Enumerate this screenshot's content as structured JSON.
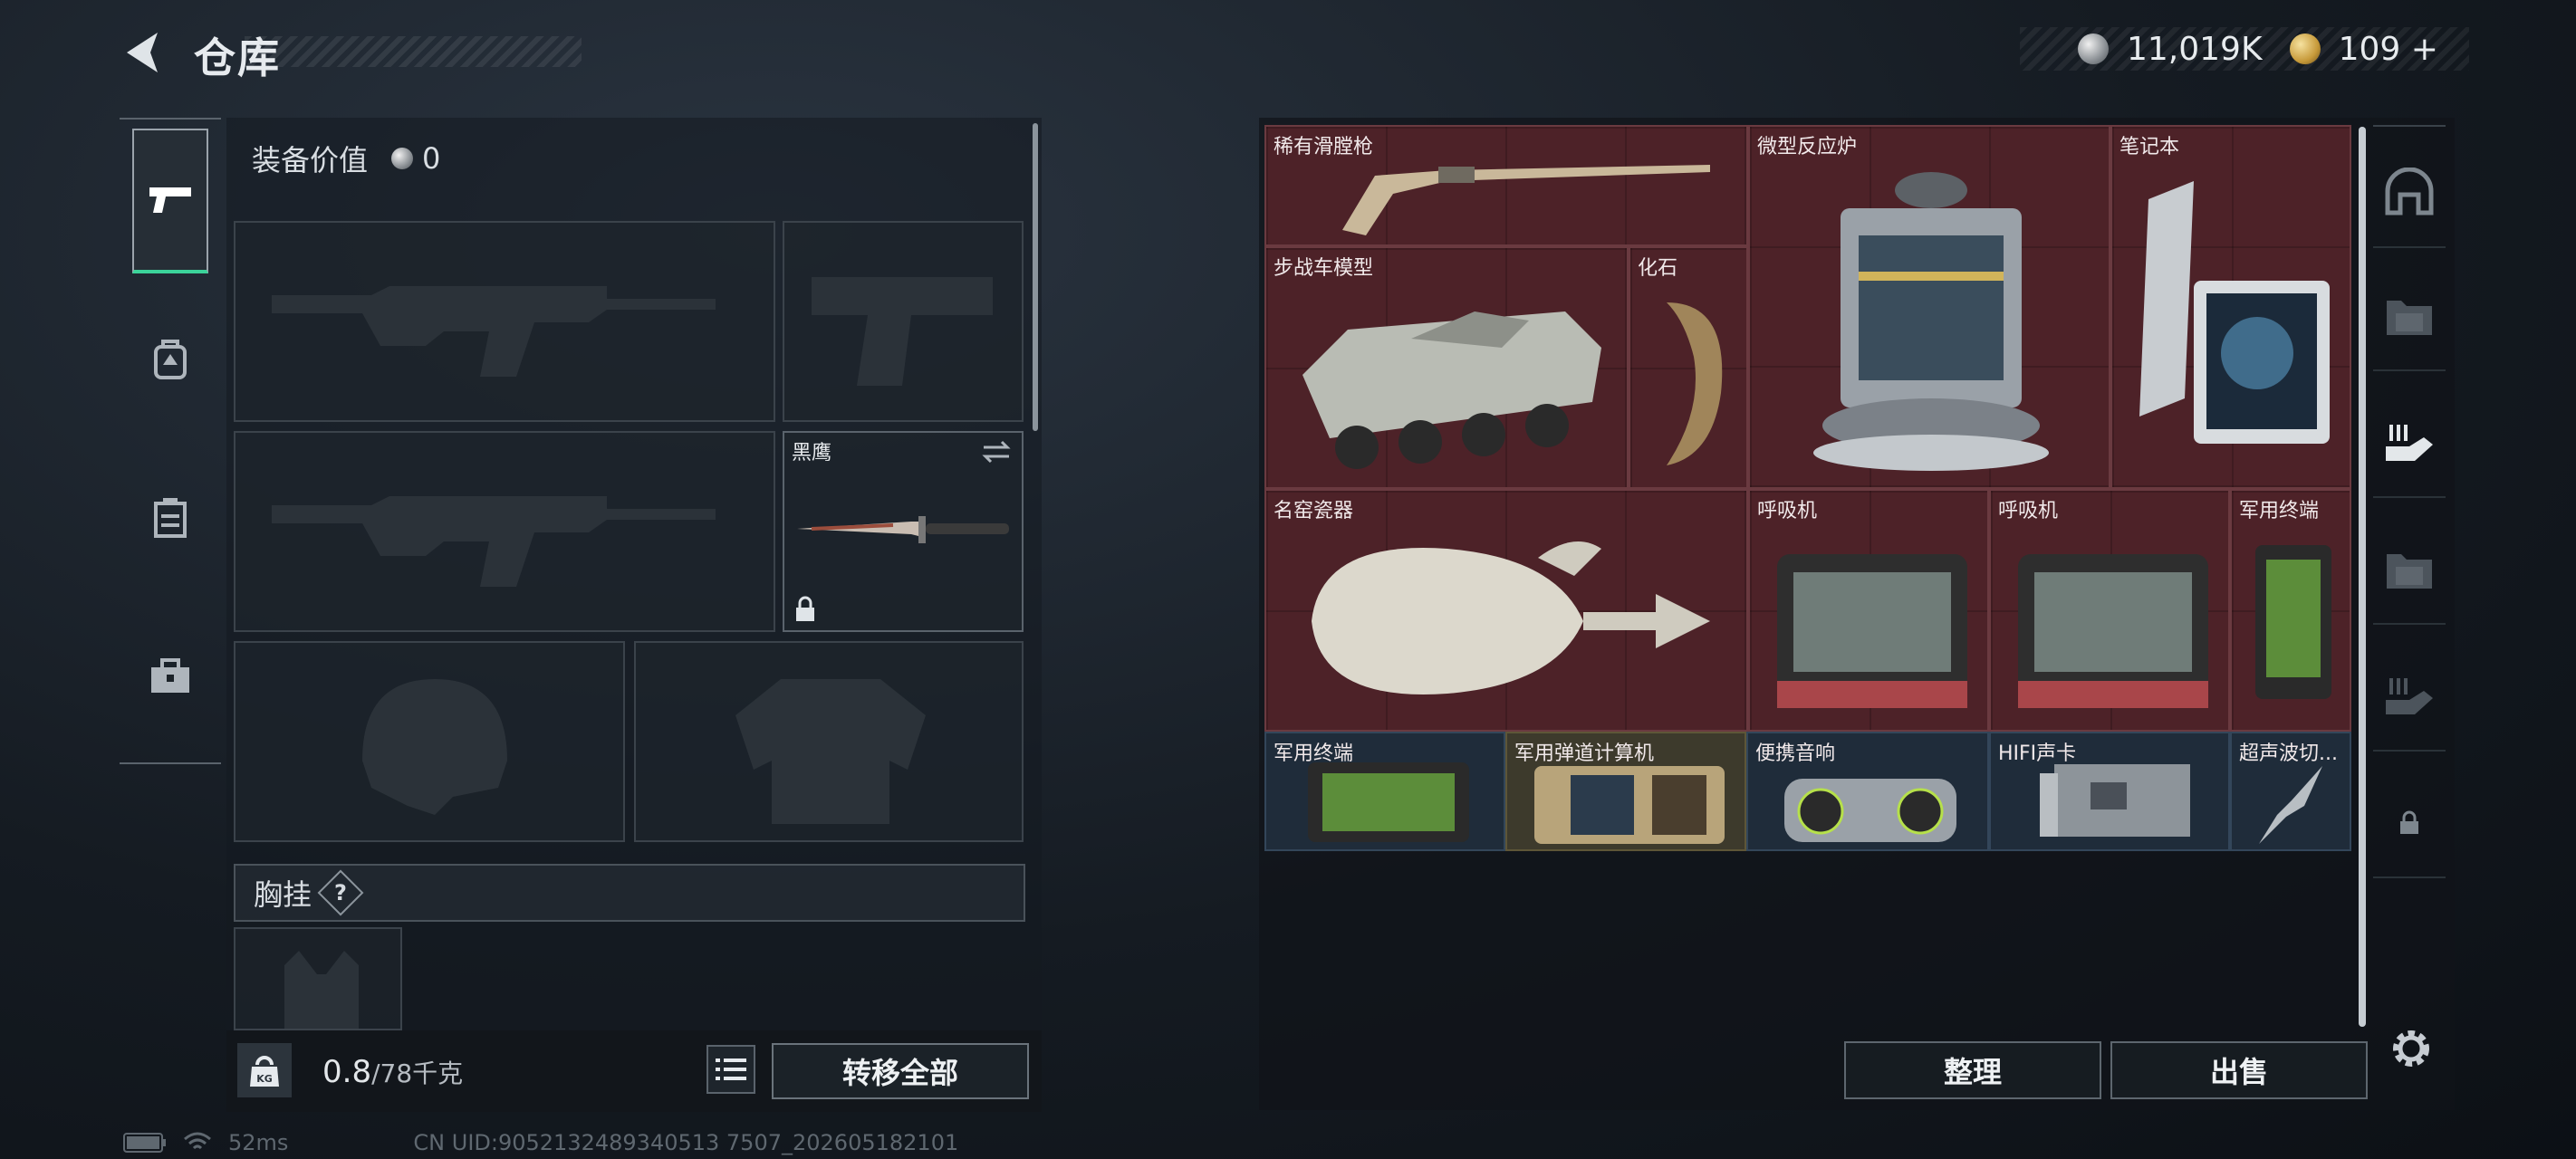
{
  "header": {
    "title": "仓库",
    "silver_currency": "11,019K",
    "gold_currency": "109",
    "gold_add": "+"
  },
  "categories": [
    {
      "icon": "pistol-icon",
      "active": true
    },
    {
      "icon": "backpack-icon",
      "active": false
    },
    {
      "icon": "vest-icon",
      "active": false
    },
    {
      "icon": "toolbox-icon",
      "active": false
    }
  ],
  "equipment": {
    "value_label": "装备价值",
    "value": "0",
    "knife_slot_name": "黑鹰",
    "chest_rig_label": "胸挂",
    "chest_rig_help": "?"
  },
  "footer": {
    "weight_current": "0.8",
    "weight_max": "/78千克",
    "kg_label": "KG",
    "transfer_all": "转移全部",
    "sort": "整理",
    "sell": "出售"
  },
  "status": {
    "ping": "52ms",
    "uid": "CN UID:9052132489340513 7507_202605182101"
  },
  "storage_items": [
    {
      "name": "稀有滑膛枪"
    },
    {
      "name": "微型反应炉"
    },
    {
      "name": "笔记本"
    },
    {
      "name": "步战车模型"
    },
    {
      "name": "化石"
    },
    {
      "name": "名窑瓷器"
    },
    {
      "name": "呼吸机"
    },
    {
      "name": "呼吸机"
    },
    {
      "name": "军用终端"
    },
    {
      "name": "军用终端"
    },
    {
      "name": "军用弹道计算机"
    },
    {
      "name": "便携音响"
    },
    {
      "name": "HIFI声卡"
    },
    {
      "name": "超声波切..."
    }
  ],
  "colors": {
    "rare_cell": "#4d2228",
    "blue_cell": "#1f2c3a",
    "gold_cell": "#3d3a2c",
    "active_accent": "#3bd39a"
  }
}
